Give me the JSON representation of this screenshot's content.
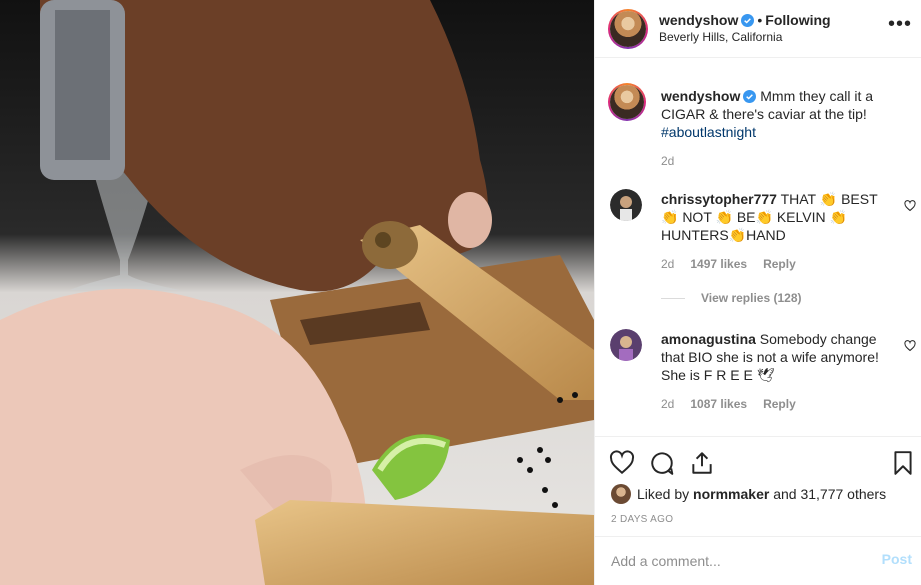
{
  "photo": {
    "icon": "post-photo"
  },
  "header": {
    "username": "wendyshow",
    "separator": "•",
    "follow_label": "Following",
    "location": "Beverly Hills, California",
    "more_icon": "more-dots-icon"
  },
  "caption": {
    "username": "wendyshow",
    "text": "Mmm they call it a CIGAR & there's caviar at the tip!",
    "hashtag": "#aboutlastnight",
    "time": "2d"
  },
  "comments": [
    {
      "username": "chrissytopher777",
      "text": "THAT 👏 BEST 👏 NOT 👏 BE👏 KELVIN 👏 HUNTERS👏HAND",
      "time": "2d",
      "likes": "1497 likes",
      "reply": "Reply",
      "view_replies": "View replies (128)"
    },
    {
      "username": "amonagustina",
      "text": "Somebody change that BIO she is not a wife anymore! She is F R E E 🕊",
      "time": "2d",
      "likes": "1087 likes",
      "reply": "Reply"
    }
  ],
  "likes": {
    "prefix": "Liked by ",
    "user": "normmaker",
    "suffix": " and 31,777 others"
  },
  "date": "2 DAYS AGO",
  "add_comment": {
    "placeholder": "Add a comment...",
    "post_label": "Post"
  },
  "colors": {
    "link_blue": "#00376b",
    "verified_blue": "#3897f0",
    "post_disabled": "#b2dffc",
    "muted": "#8e8e8e"
  }
}
